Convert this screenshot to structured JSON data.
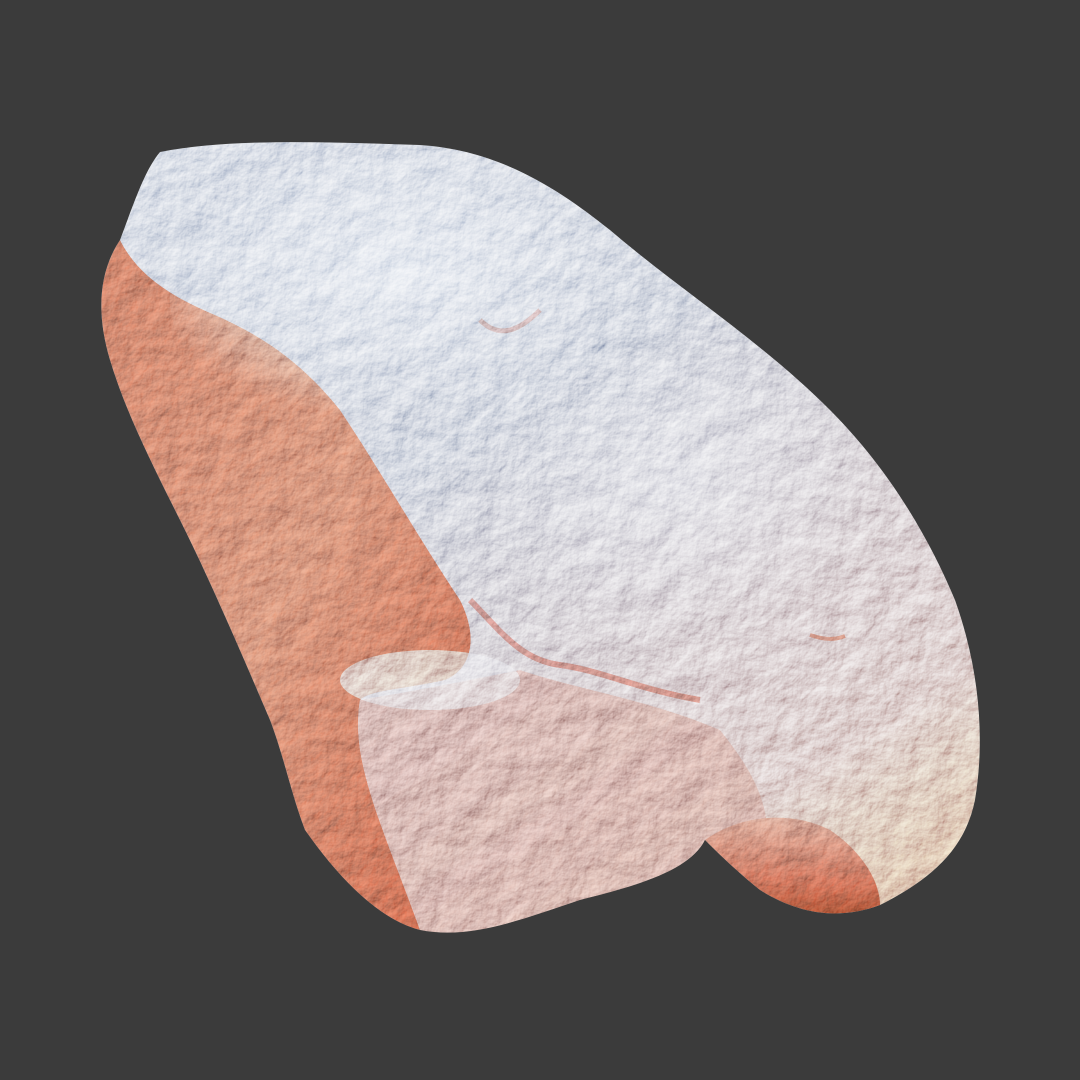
{
  "scene": {
    "background_color": "#3b3b3b",
    "subject": "rock",
    "colors": {
      "highlight": "#c9d6ea",
      "mid": "#8a93a8",
      "shadow_warm": "#a85a3e",
      "deep_shadow": "#6e2a17"
    }
  }
}
